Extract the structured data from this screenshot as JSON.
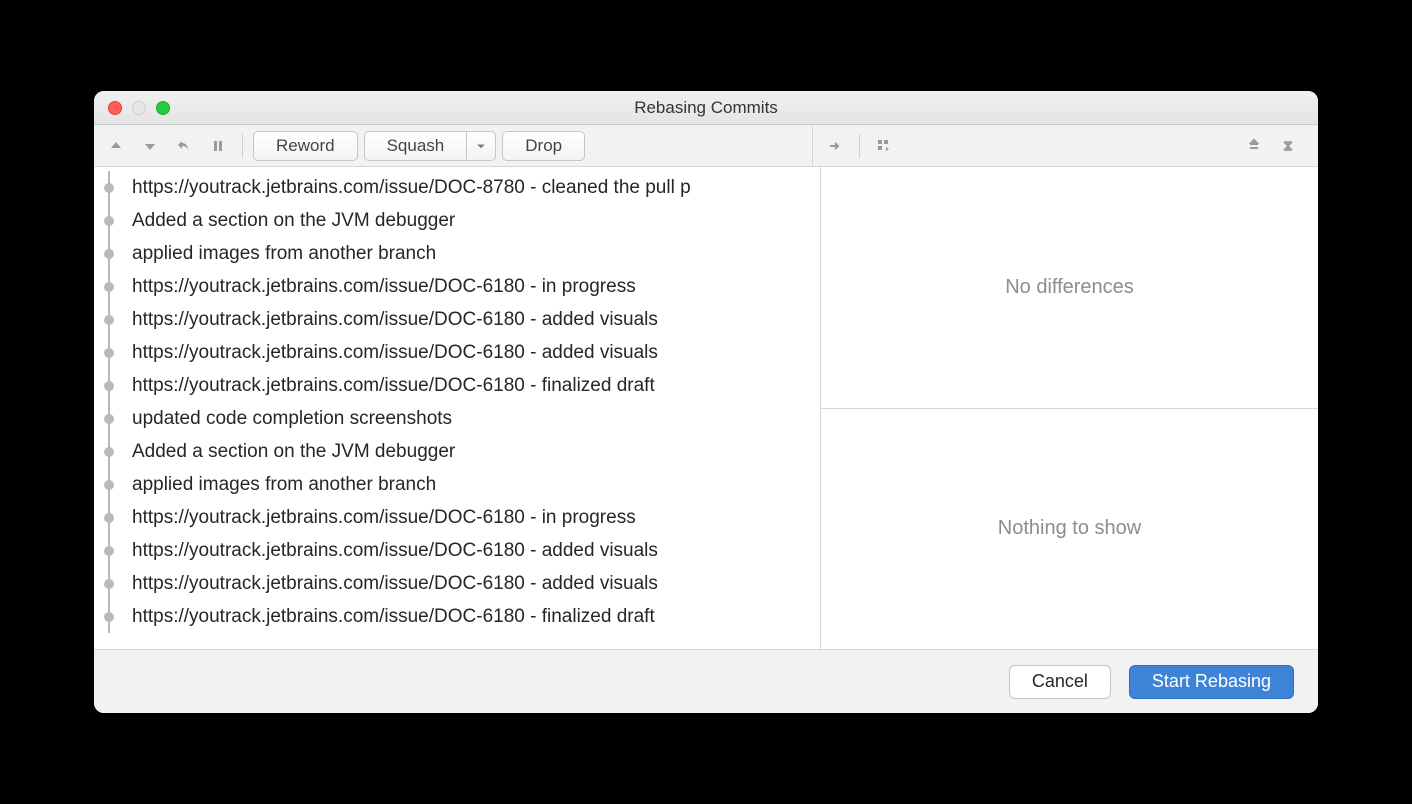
{
  "window": {
    "title": "Rebasing Commits"
  },
  "toolbar": {
    "reword": "Reword",
    "squash": "Squash",
    "drop": "Drop"
  },
  "commits": [
    "https://youtrack.jetbrains.com/issue/DOC-8780 - cleaned the pull p",
    "Added a section on the JVM debugger",
    "applied images from another branch",
    "https://youtrack.jetbrains.com/issue/DOC-6180 - in progress",
    "https://youtrack.jetbrains.com/issue/DOC-6180 - added visuals",
    "https://youtrack.jetbrains.com/issue/DOC-6180 - added visuals",
    "https://youtrack.jetbrains.com/issue/DOC-6180 - finalized draft",
    "updated code completion screenshots",
    "Added a section on the JVM debugger",
    "applied images from another branch",
    "https://youtrack.jetbrains.com/issue/DOC-6180 - in progress",
    "https://youtrack.jetbrains.com/issue/DOC-6180 - added visuals",
    "https://youtrack.jetbrains.com/issue/DOC-6180 - added visuals",
    "https://youtrack.jetbrains.com/issue/DOC-6180 - finalized draft"
  ],
  "diff": {
    "top": "No differences",
    "bottom": "Nothing to show"
  },
  "footer": {
    "cancel": "Cancel",
    "start": "Start Rebasing"
  }
}
